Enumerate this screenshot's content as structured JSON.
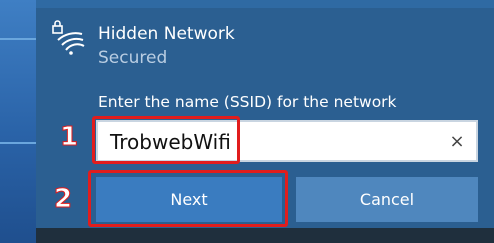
{
  "network": {
    "name": "Hidden Network",
    "status": "Secured",
    "icon": "wifi-lock-icon"
  },
  "ssid_field": {
    "prompt": "Enter the name (SSID) for the network",
    "value": "TrobwebWifi",
    "clear_icon": "×"
  },
  "buttons": {
    "next": "Next",
    "cancel": "Cancel"
  },
  "annotations": {
    "step1": "1",
    "step2": "2",
    "highlight_color": "#e11d1d"
  },
  "colors": {
    "panel": "#2b5f91",
    "next_button": "#3a7cc0",
    "cancel_button": "#4f87be"
  }
}
